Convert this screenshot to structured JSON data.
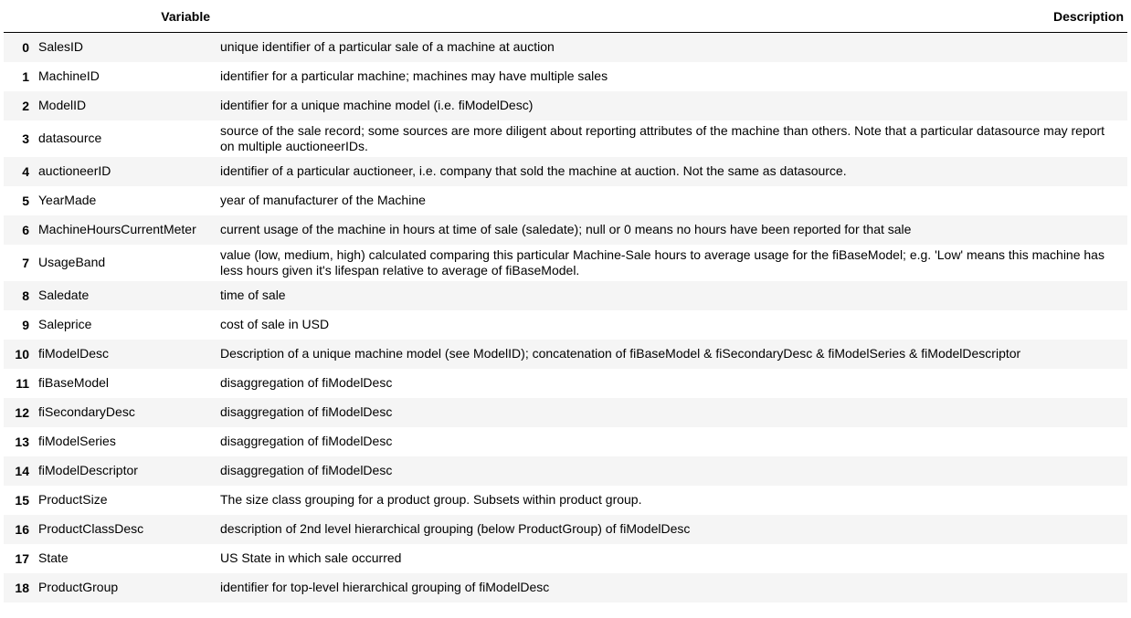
{
  "table": {
    "headers": {
      "index": "",
      "variable": "Variable",
      "description": "Description"
    },
    "rows": [
      {
        "index": "0",
        "variable": "SalesID",
        "description": "unique identifier of a particular sale of a machine at auction"
      },
      {
        "index": "1",
        "variable": "MachineID",
        "description": "identifier for a particular machine; machines may have multiple sales"
      },
      {
        "index": "2",
        "variable": "ModelID",
        "description": "identifier for a unique machine model (i.e. fiModelDesc)"
      },
      {
        "index": "3",
        "variable": "datasource",
        "description": "source of the sale record; some sources are more diligent about reporting attributes of the machine than others. Note that a particular datasource may report on multiple auctioneerIDs."
      },
      {
        "index": "4",
        "variable": "auctioneerID",
        "description": "identifier of a particular auctioneer, i.e. company that sold the machine at auction. Not the same as datasource."
      },
      {
        "index": "5",
        "variable": "YearMade",
        "description": "year of manufacturer of the Machine"
      },
      {
        "index": "6",
        "variable": "MachineHoursCurrentMeter",
        "description": "current usage of the machine in hours at time of sale (saledate); null or 0 means no hours have been reported for that sale"
      },
      {
        "index": "7",
        "variable": "UsageBand",
        "description": "value (low, medium, high) calculated comparing this particular Machine-Sale hours to average usage for the fiBaseModel; e.g. 'Low' means this machine has less hours given it's lifespan relative to average of fiBaseModel."
      },
      {
        "index": "8",
        "variable": "Saledate",
        "description": "time of sale"
      },
      {
        "index": "9",
        "variable": "Saleprice",
        "description": "cost of sale in USD"
      },
      {
        "index": "10",
        "variable": "fiModelDesc",
        "description": "Description of a unique machine model (see ModelID); concatenation of fiBaseModel & fiSecondaryDesc & fiModelSeries & fiModelDescriptor"
      },
      {
        "index": "11",
        "variable": "fiBaseModel",
        "description": "disaggregation of fiModelDesc"
      },
      {
        "index": "12",
        "variable": "fiSecondaryDesc",
        "description": "disaggregation of fiModelDesc"
      },
      {
        "index": "13",
        "variable": "fiModelSeries",
        "description": "disaggregation of fiModelDesc"
      },
      {
        "index": "14",
        "variable": "fiModelDescriptor",
        "description": "disaggregation of fiModelDesc"
      },
      {
        "index": "15",
        "variable": "ProductSize",
        "description": "The size class grouping for a product group. Subsets within product group."
      },
      {
        "index": "16",
        "variable": "ProductClassDesc",
        "description": "description of 2nd level hierarchical grouping (below ProductGroup) of fiModelDesc"
      },
      {
        "index": "17",
        "variable": "State",
        "description": "US State in which sale occurred"
      },
      {
        "index": "18",
        "variable": "ProductGroup",
        "description": "identifier for top-level hierarchical grouping of fiModelDesc"
      }
    ]
  }
}
